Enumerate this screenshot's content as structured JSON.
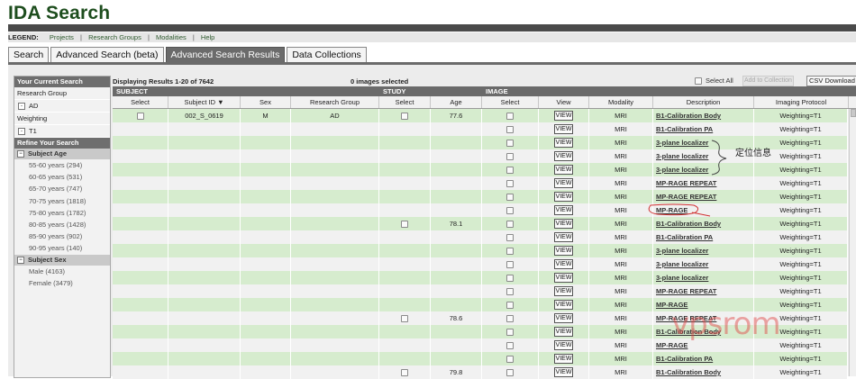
{
  "app": {
    "title": "IDA Search"
  },
  "legend": {
    "label": "LEGEND:",
    "links": [
      "Projects",
      "Research Groups",
      "Modalities",
      "Help"
    ]
  },
  "tabs": [
    {
      "label": "Search",
      "active": false
    },
    {
      "label": "Advanced Search (beta)",
      "active": false
    },
    {
      "label": "Advanced Search Results",
      "active": true
    },
    {
      "label": "Data Collections",
      "active": false
    }
  ],
  "sidebar": {
    "current_search_title": "Your Current Search",
    "current_search_items": [
      {
        "label": "Research Group",
        "has_box": false
      },
      {
        "label": "AD",
        "has_box": true
      },
      {
        "label": "Weighting",
        "has_box": false
      },
      {
        "label": "T1",
        "has_box": true
      }
    ],
    "refine_title": "Refine Your Search",
    "facets": [
      {
        "title": "Subject Age",
        "items": [
          "55-60 years (294)",
          "60-65 years (531)",
          "65-70 years (747)",
          "70-75 years (1818)",
          "75-80 years (1782)",
          "80-85 years (1428)",
          "85-90 years (902)",
          "90-95 years (140)"
        ]
      },
      {
        "title": "Subject Sex",
        "items": [
          "Male (4163)",
          "Female (3479)"
        ]
      }
    ]
  },
  "results": {
    "displaying": "Displaying Results 1-20 of 7642",
    "selected": "0 images selected",
    "select_all": "Select All",
    "add_to_collection": "Add to Collection",
    "csv_download": "CSV Download",
    "group_headers": [
      "SUBJECT",
      "STUDY",
      "IMAGE"
    ],
    "columns": [
      "Select",
      "Subject ID ▼",
      "Sex",
      "Research Group",
      "Select",
      "Age",
      "Select",
      "View",
      "Modality",
      "Description",
      "Imaging Protocol"
    ],
    "view_label": "VIEW",
    "rows": [
      {
        "subject_select": true,
        "subject_id": "002_S_0619",
        "sex": "M",
        "group": "AD",
        "study_select": true,
        "age": "77.6",
        "modality": "MRI",
        "description": "B1-Calibration Body",
        "protocol": "Weighting=T1"
      },
      {
        "subject_select": false,
        "subject_id": "",
        "sex": "",
        "group": "",
        "study_select": false,
        "age": "",
        "modality": "MRI",
        "description": "B1-Calibration PA",
        "protocol": "Weighting=T1"
      },
      {
        "subject_select": false,
        "subject_id": "",
        "sex": "",
        "group": "",
        "study_select": false,
        "age": "",
        "modality": "MRI",
        "description": "3-plane localizer",
        "protocol": "Weighting=T1"
      },
      {
        "subject_select": false,
        "subject_id": "",
        "sex": "",
        "group": "",
        "study_select": false,
        "age": "",
        "modality": "MRI",
        "description": "3-plane localizer",
        "protocol": "Weighting=T1"
      },
      {
        "subject_select": false,
        "subject_id": "",
        "sex": "",
        "group": "",
        "study_select": false,
        "age": "",
        "modality": "MRI",
        "description": "3-plane localizer",
        "protocol": "Weighting=T1"
      },
      {
        "subject_select": false,
        "subject_id": "",
        "sex": "",
        "group": "",
        "study_select": false,
        "age": "",
        "modality": "MRI",
        "description": "MP-RAGE REPEAT",
        "protocol": "Weighting=T1"
      },
      {
        "subject_select": false,
        "subject_id": "",
        "sex": "",
        "group": "",
        "study_select": false,
        "age": "",
        "modality": "MRI",
        "description": "MP-RAGE REPEAT",
        "protocol": "Weighting=T1"
      },
      {
        "subject_select": false,
        "subject_id": "",
        "sex": "",
        "group": "",
        "study_select": false,
        "age": "",
        "modality": "MRI",
        "description": "MP-RAGE",
        "protocol": "Weighting=T1"
      },
      {
        "subject_select": false,
        "subject_id": "",
        "sex": "",
        "group": "",
        "study_select": true,
        "age": "78.1",
        "modality": "MRI",
        "description": "B1-Calibration Body",
        "protocol": "Weighting=T1"
      },
      {
        "subject_select": false,
        "subject_id": "",
        "sex": "",
        "group": "",
        "study_select": false,
        "age": "",
        "modality": "MRI",
        "description": "B1-Calibration PA",
        "protocol": "Weighting=T1"
      },
      {
        "subject_select": false,
        "subject_id": "",
        "sex": "",
        "group": "",
        "study_select": false,
        "age": "",
        "modality": "MRI",
        "description": "3-plane localizer",
        "protocol": "Weighting=T1"
      },
      {
        "subject_select": false,
        "subject_id": "",
        "sex": "",
        "group": "",
        "study_select": false,
        "age": "",
        "modality": "MRI",
        "description": "3-plane localizer",
        "protocol": "Weighting=T1"
      },
      {
        "subject_select": false,
        "subject_id": "",
        "sex": "",
        "group": "",
        "study_select": false,
        "age": "",
        "modality": "MRI",
        "description": "3-plane localizer",
        "protocol": "Weighting=T1"
      },
      {
        "subject_select": false,
        "subject_id": "",
        "sex": "",
        "group": "",
        "study_select": false,
        "age": "",
        "modality": "MRI",
        "description": "MP-RAGE REPEAT",
        "protocol": "Weighting=T1"
      },
      {
        "subject_select": false,
        "subject_id": "",
        "sex": "",
        "group": "",
        "study_select": false,
        "age": "",
        "modality": "MRI",
        "description": "MP-RAGE",
        "protocol": "Weighting=T1"
      },
      {
        "subject_select": false,
        "subject_id": "",
        "sex": "",
        "group": "",
        "study_select": true,
        "age": "78.6",
        "modality": "MRI",
        "description": "MP-RAGE REPEAT",
        "protocol": "Weighting=T1"
      },
      {
        "subject_select": false,
        "subject_id": "",
        "sex": "",
        "group": "",
        "study_select": false,
        "age": "",
        "modality": "MRI",
        "description": "B1-Calibration Body",
        "protocol": "Weighting=T1"
      },
      {
        "subject_select": false,
        "subject_id": "",
        "sex": "",
        "group": "",
        "study_select": false,
        "age": "",
        "modality": "MRI",
        "description": "MP-RAGE",
        "protocol": "Weighting=T1"
      },
      {
        "subject_select": false,
        "subject_id": "",
        "sex": "",
        "group": "",
        "study_select": false,
        "age": "",
        "modality": "MRI",
        "description": "B1-Calibration PA",
        "protocol": "Weighting=T1"
      },
      {
        "subject_select": false,
        "subject_id": "",
        "sex": "",
        "group": "",
        "study_select": true,
        "age": "79.8",
        "modality": "MRI",
        "description": "B1-Calibration Body",
        "protocol": "Weighting=T1"
      }
    ]
  },
  "annotation": {
    "text": "定位信息",
    "color": "#d03030"
  },
  "watermark": {
    "text": "vpsrom"
  }
}
